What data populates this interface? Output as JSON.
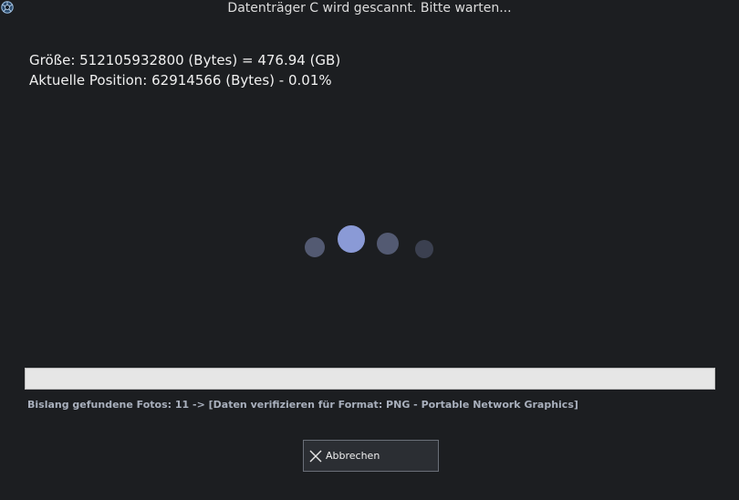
{
  "window": {
    "title": "Datenträger C wird gescannt. Bitte warten...",
    "app_icon": "aperture-icon"
  },
  "scan_info": {
    "size_line": "Größe: 512105932800 (Bytes) = 476.94 (GB)",
    "position_line": "Aktuelle Position: 62914566 (Bytes) - 0.01%"
  },
  "progress": {
    "percent": 0.01
  },
  "status": {
    "text": "Bislang gefundene Fotos: 11 -> [Daten verifizieren für Format: PNG - Portable Network Graphics]"
  },
  "cancel_button": {
    "label": "Abbrechen",
    "icon": "close-icon"
  },
  "colors": {
    "background": "#1c1e21",
    "spinner_active": "#8a9ad6",
    "spinner_dot": "#535a72",
    "spinner_faint": "#3b4050"
  }
}
